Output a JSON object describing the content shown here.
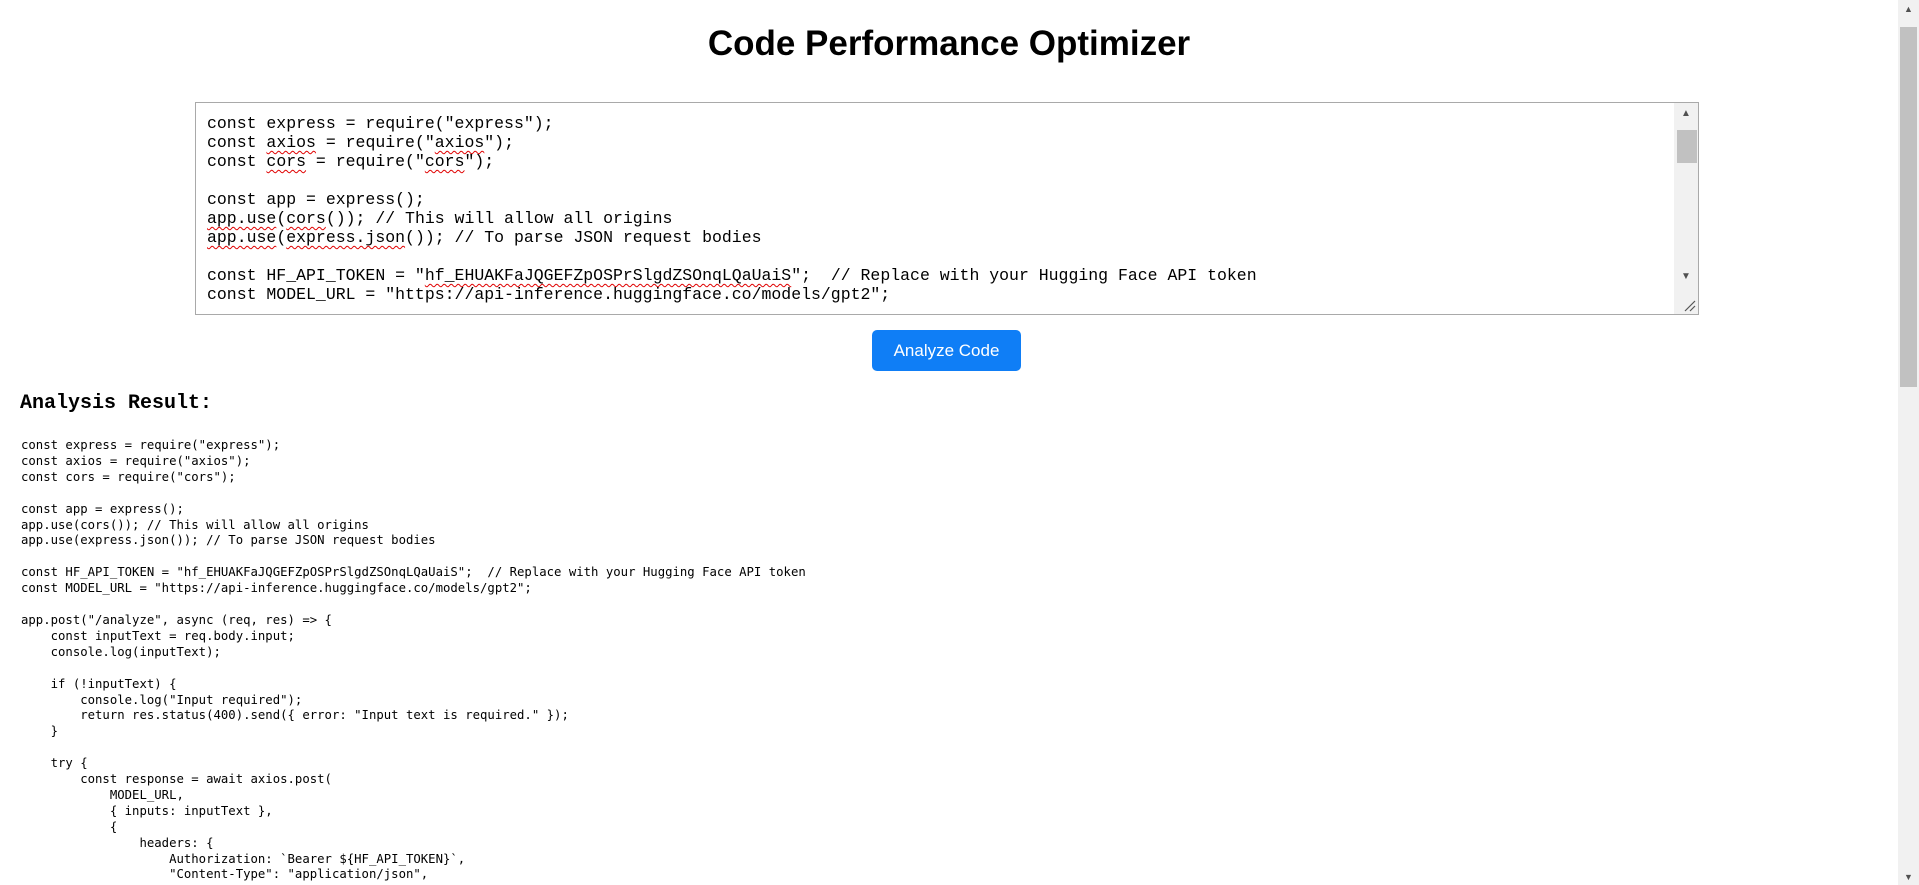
{
  "page": {
    "title": "Code Performance Optimizer"
  },
  "editor": {
    "lines": [
      [
        {
          "t": "const express = require(\"express\");"
        }
      ],
      [
        {
          "t": "const "
        },
        {
          "t": "axios",
          "sq": true
        },
        {
          "t": " = require(\""
        },
        {
          "t": "axios",
          "sq": true
        },
        {
          "t": "\");"
        }
      ],
      [
        {
          "t": "const "
        },
        {
          "t": "cors",
          "sq": true
        },
        {
          "t": " = require(\""
        },
        {
          "t": "cors",
          "sq": true
        },
        {
          "t": "\");"
        }
      ],
      [
        {
          "t": ""
        }
      ],
      [
        {
          "t": "const app = express();"
        }
      ],
      [
        {
          "t": "app.use",
          "sq": true
        },
        {
          "t": "("
        },
        {
          "t": "cors",
          "sq": true
        },
        {
          "t": "()); // This will allow all origins"
        }
      ],
      [
        {
          "t": "app.use",
          "sq": true
        },
        {
          "t": "("
        },
        {
          "t": "express.json",
          "sq": true
        },
        {
          "t": "()); // To parse JSON request bodies"
        }
      ],
      [
        {
          "t": ""
        }
      ],
      [
        {
          "t": "const HF_API_TOKEN = \""
        },
        {
          "t": "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",
          "sq": true
        },
        {
          "t": "\";  // Replace with your Hugging Face API token"
        }
      ],
      [
        {
          "t": "const MODEL_URL = \"https://api-inference.huggingface.co/models/gpt2\";"
        }
      ]
    ],
    "scroll_up_icon": "triangle-up",
    "scroll_down_icon": "triangle-down"
  },
  "analyze_button": {
    "label": "Analyze Code"
  },
  "result": {
    "title": "Analysis Result:",
    "code": "const express = require(\"express\");\nconst axios = require(\"axios\");\nconst cors = require(\"cors\");\n\nconst app = express();\napp.use(cors()); // This will allow all origins\napp.use(express.json()); // To parse JSON request bodies\n\nconst HF_API_TOKEN = \"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\";  // Replace with your Hugging Face API token\nconst MODEL_URL = \"https://api-inference.huggingface.co/models/gpt2\";\n\napp.post(\"/analyze\", async (req, res) => {\n    const inputText = req.body.input;\n    console.log(inputText);\n\n    if (!inputText) {\n        console.log(\"Input required\");\n        return res.status(400).send({ error: \"Input text is required.\" });\n    }\n\n    try {\n        const response = await axios.post(\n            MODEL_URL,\n            { inputs: inputText },\n            {\n                headers: {\n                    Authorization: `Bearer ${HF_API_TOKEN}`,\n                    \"Content-Type\": \"application/json\","
  },
  "colors": {
    "button": "#0f7ef6",
    "squiggle": "#e00000",
    "scrollbar_track": "#f1f1f1",
    "scrollbar_thumb": "#c1c1c1"
  }
}
